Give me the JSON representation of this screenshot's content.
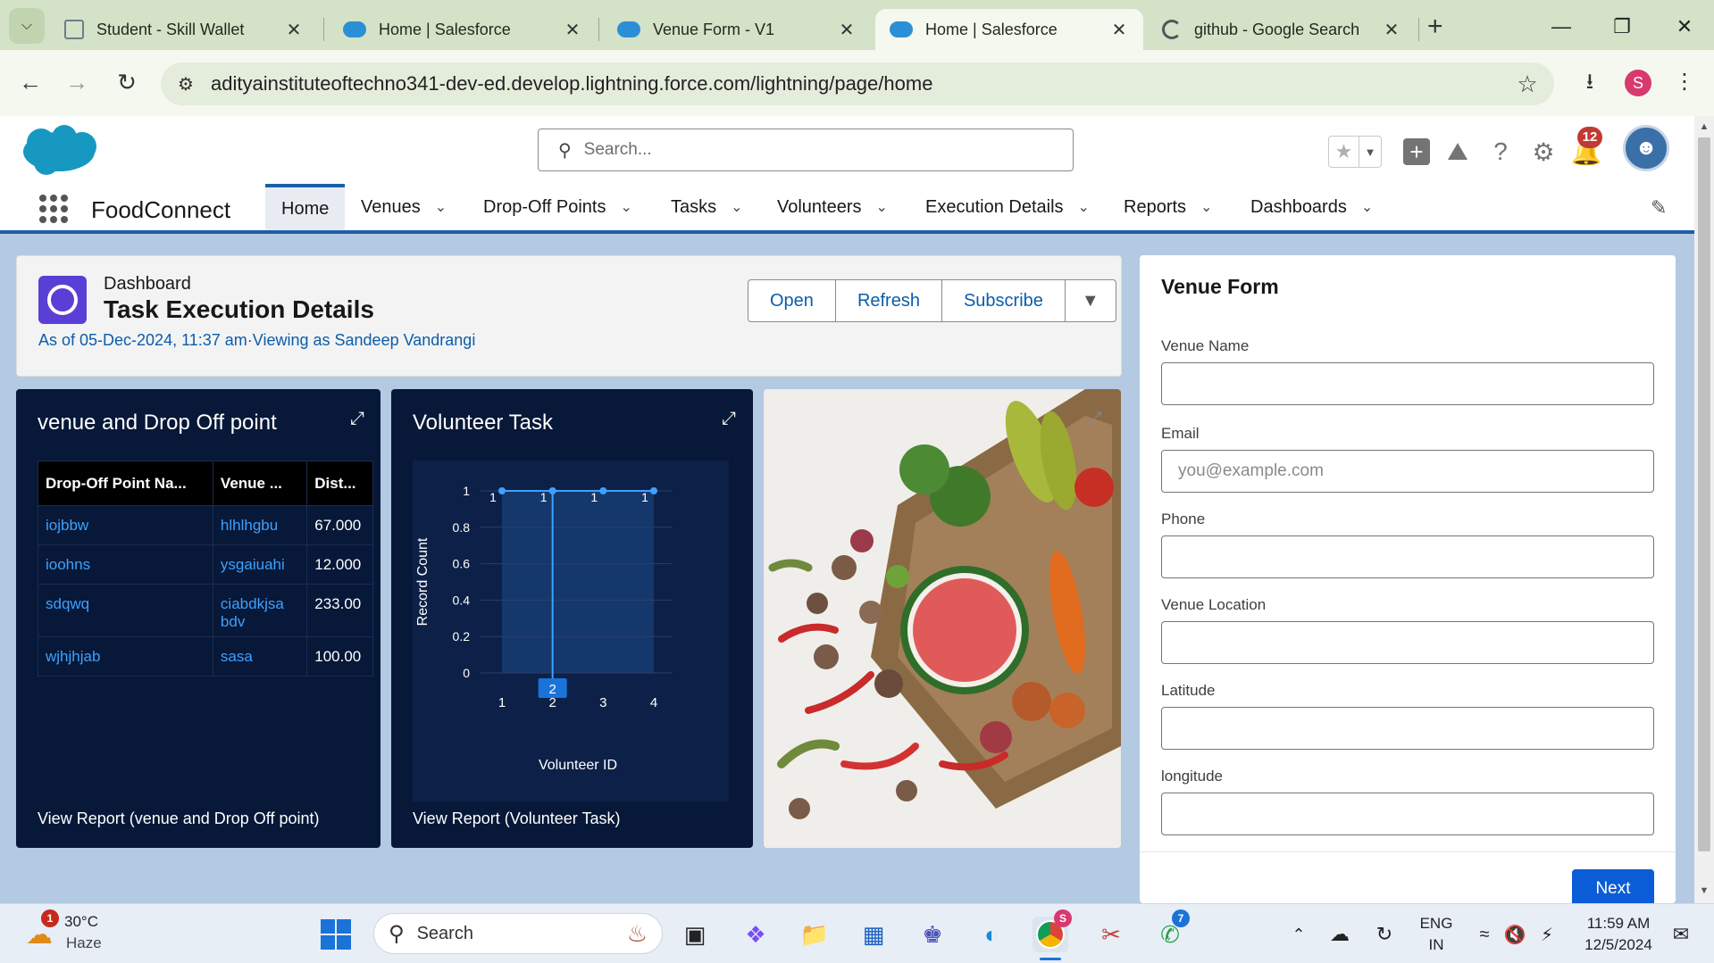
{
  "browser": {
    "tabs": [
      {
        "title": "Student - Skill Wallet",
        "icon": "document-icon"
      },
      {
        "title": "Home | Salesforce",
        "icon": "salesforce-cloud-icon"
      },
      {
        "title": "Venue Form - V1",
        "icon": "salesforce-cloud-icon"
      },
      {
        "title": "Home | Salesforce",
        "icon": "salesforce-cloud-icon",
        "active": true
      },
      {
        "title": "github - Google Search",
        "icon": "google-icon"
      }
    ],
    "close_glyph": "✕",
    "url": "adityainstituteoftechno341-dev-ed.develop.lightning.force.com/lightning/page/home",
    "profile_initial": "S"
  },
  "sf": {
    "search_placeholder": "Search...",
    "notification_count": "12",
    "app_name": "FoodConnect",
    "nav": [
      {
        "label": "Home",
        "active": true
      },
      {
        "label": "Venues"
      },
      {
        "label": "Drop-Off Points"
      },
      {
        "label": "Tasks"
      },
      {
        "label": "Volunteers"
      },
      {
        "label": "Execution Details"
      },
      {
        "label": "Reports"
      },
      {
        "label": "Dashboards"
      }
    ]
  },
  "dashboard": {
    "label": "Dashboard",
    "title": "Task Execution Details",
    "subtitle": "As of 05-Dec-2024, 11:37 am·Viewing as Sandeep Vandrangi",
    "buttons": {
      "open": "Open",
      "refresh": "Refresh",
      "subscribe": "Subscribe"
    },
    "table_card": {
      "title": "venue and Drop Off point",
      "columns": [
        "Drop-Off Point Na...",
        "Venue ...",
        "Dist..."
      ],
      "rows": [
        [
          "iojbbw",
          "hlhlhgbu",
          "67.000"
        ],
        [
          "ioohns",
          "ysgaiuahi",
          "12.000"
        ],
        [
          "sdqwq",
          "ciabdkjsa bdv",
          "233.00"
        ],
        [
          "wjhjhjab",
          "sasa",
          "100.00"
        ]
      ],
      "footer": "View Report (venue and Drop Off point)"
    },
    "chart_card": {
      "title": "Volunteer Task",
      "footer": "View Report (Volunteer Task)"
    }
  },
  "chart_data": {
    "type": "line",
    "title": "Volunteer Task",
    "xlabel": "Volunteer ID",
    "ylabel": "Record Count",
    "x": [
      "1",
      "2",
      "3",
      "4"
    ],
    "series": [
      {
        "values": [
          1,
          1,
          1,
          1
        ]
      }
    ],
    "data_labels": [
      "1",
      "1",
      "1",
      "1"
    ],
    "yticks": [
      "0",
      "0.2",
      "0.4",
      "0.6",
      "0.8",
      "1"
    ],
    "ylim": [
      0,
      1
    ],
    "highlighted_x": "2",
    "grid": true,
    "colors": {
      "line": "#3ea1ff",
      "plot_bg": "#0d2148",
      "highlight": "#1c4a8a"
    }
  },
  "venue_form": {
    "title": "Venue Form",
    "fields": [
      {
        "label": "Venue Name",
        "placeholder": ""
      },
      {
        "label": "Email",
        "placeholder": "you@example.com"
      },
      {
        "label": "Phone",
        "placeholder": ""
      },
      {
        "label": "Venue Location",
        "placeholder": ""
      },
      {
        "label": "Latitude",
        "placeholder": ""
      },
      {
        "label": "longitude",
        "placeholder": ""
      }
    ],
    "next_label": "Next"
  },
  "taskbar": {
    "weather_temp": "30°C",
    "weather_desc": "Haze",
    "weather_badge": "1",
    "search_label": "Search",
    "lang_top": "ENG",
    "lang_bottom": "IN",
    "time": "11:59 AM",
    "date": "12/5/2024",
    "chrome_badge": "S",
    "whatsapp_badge": "7"
  },
  "colors": {
    "sf_blue": "#0b5cab",
    "dash_card_bg": "#071838",
    "nav_accent": "#1b5fa8"
  }
}
